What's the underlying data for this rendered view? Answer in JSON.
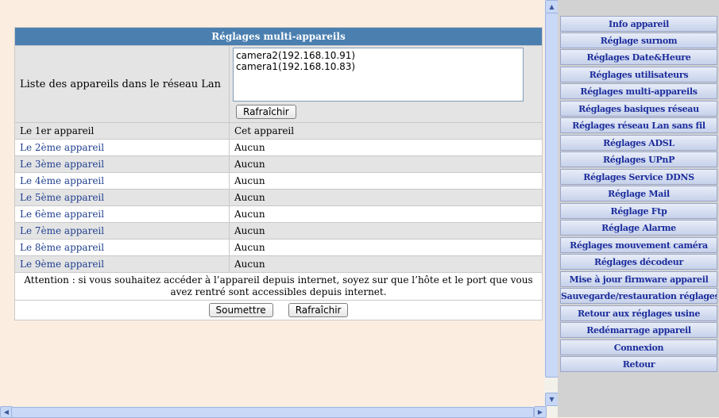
{
  "panel": {
    "title": "Réglages multi-appareils",
    "lan_label": "Liste des appareils dans le réseau Lan",
    "lan_devices": [
      "camera2(192.168.10.91)",
      "camera1(192.168.10.83)"
    ],
    "refresh_label": "Rafraîchir"
  },
  "devices": [
    {
      "label": "Le 1er appareil",
      "value": "Cet appareil"
    },
    {
      "label": "Le 2ème appareil",
      "value": "Aucun"
    },
    {
      "label": "Le 3ème appareil",
      "value": "Aucun"
    },
    {
      "label": "Le 4ème appareil",
      "value": "Aucun"
    },
    {
      "label": "Le 5ème appareil",
      "value": "Aucun"
    },
    {
      "label": "Le 6ème appareil",
      "value": "Aucun"
    },
    {
      "label": "Le 7ème appareil",
      "value": "Aucun"
    },
    {
      "label": "Le 8ème appareil",
      "value": "Aucun"
    },
    {
      "label": "Le 9ème appareil",
      "value": "Aucun"
    }
  ],
  "notice": "Attention : si vous souhaitez accéder à l’appareil depuis internet, soyez sur que l’hôte et le port que vous avez rentré sont accessibles depuis internet.",
  "actions": {
    "submit_label": "Soumettre",
    "refresh_label": "Rafraîchir"
  },
  "nav": {
    "items": [
      "Info appareil",
      "Réglage surnom",
      "Réglages Date&Heure",
      "Réglages utilisateurs",
      "Réglages multi-appareils",
      "Réglages basiques réseau",
      "Réglages réseau Lan sans fil",
      "Réglages ADSL",
      "Réglages UPnP",
      "Réglages Service DDNS",
      "Réglage Mail",
      "Réglage Ftp",
      "Réglage Alarme",
      "Réglages mouvement caméra",
      "Réglages décodeur",
      "Mise à jour firmware appareil",
      "Sauvegarde/restauration réglages",
      "Retour aux réglages usine",
      "Redémarrage appareil",
      "Connexion",
      "Retour"
    ]
  },
  "colors": {
    "header": "#4a7fb0",
    "nav_text": "#1c2d9c",
    "link": "#1f3f8f",
    "background": "#fbeee0"
  },
  "icons": {
    "scroll_up": "scroll-up-arrow",
    "scroll_down": "scroll-down-arrow",
    "scroll_left": "scroll-left-arrow",
    "scroll_right": "scroll-right-arrow"
  }
}
